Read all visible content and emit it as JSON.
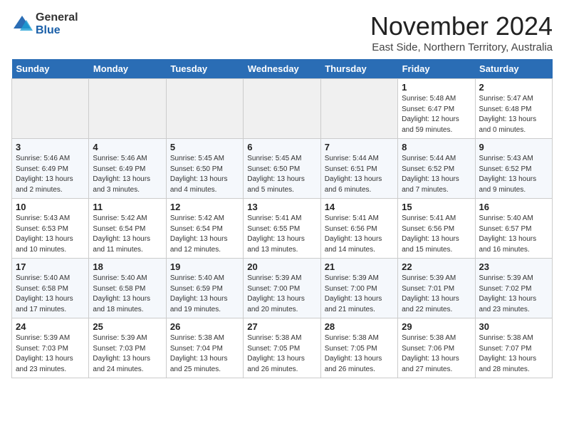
{
  "header": {
    "logo_general": "General",
    "logo_blue": "Blue",
    "month_title": "November 2024",
    "location": "East Side, Northern Territory, Australia"
  },
  "weekdays": [
    "Sunday",
    "Monday",
    "Tuesday",
    "Wednesday",
    "Thursday",
    "Friday",
    "Saturday"
  ],
  "weeks": [
    [
      {
        "day": "",
        "detail": ""
      },
      {
        "day": "",
        "detail": ""
      },
      {
        "day": "",
        "detail": ""
      },
      {
        "day": "",
        "detail": ""
      },
      {
        "day": "",
        "detail": ""
      },
      {
        "day": "1",
        "detail": "Sunrise: 5:48 AM\nSunset: 6:47 PM\nDaylight: 12 hours and 59 minutes."
      },
      {
        "day": "2",
        "detail": "Sunrise: 5:47 AM\nSunset: 6:48 PM\nDaylight: 13 hours and 0 minutes."
      }
    ],
    [
      {
        "day": "3",
        "detail": "Sunrise: 5:46 AM\nSunset: 6:49 PM\nDaylight: 13 hours and 2 minutes."
      },
      {
        "day": "4",
        "detail": "Sunrise: 5:46 AM\nSunset: 6:49 PM\nDaylight: 13 hours and 3 minutes."
      },
      {
        "day": "5",
        "detail": "Sunrise: 5:45 AM\nSunset: 6:50 PM\nDaylight: 13 hours and 4 minutes."
      },
      {
        "day": "6",
        "detail": "Sunrise: 5:45 AM\nSunset: 6:50 PM\nDaylight: 13 hours and 5 minutes."
      },
      {
        "day": "7",
        "detail": "Sunrise: 5:44 AM\nSunset: 6:51 PM\nDaylight: 13 hours and 6 minutes."
      },
      {
        "day": "8",
        "detail": "Sunrise: 5:44 AM\nSunset: 6:52 PM\nDaylight: 13 hours and 7 minutes."
      },
      {
        "day": "9",
        "detail": "Sunrise: 5:43 AM\nSunset: 6:52 PM\nDaylight: 13 hours and 9 minutes."
      }
    ],
    [
      {
        "day": "10",
        "detail": "Sunrise: 5:43 AM\nSunset: 6:53 PM\nDaylight: 13 hours and 10 minutes."
      },
      {
        "day": "11",
        "detail": "Sunrise: 5:42 AM\nSunset: 6:54 PM\nDaylight: 13 hours and 11 minutes."
      },
      {
        "day": "12",
        "detail": "Sunrise: 5:42 AM\nSunset: 6:54 PM\nDaylight: 13 hours and 12 minutes."
      },
      {
        "day": "13",
        "detail": "Sunrise: 5:41 AM\nSunset: 6:55 PM\nDaylight: 13 hours and 13 minutes."
      },
      {
        "day": "14",
        "detail": "Sunrise: 5:41 AM\nSunset: 6:56 PM\nDaylight: 13 hours and 14 minutes."
      },
      {
        "day": "15",
        "detail": "Sunrise: 5:41 AM\nSunset: 6:56 PM\nDaylight: 13 hours and 15 minutes."
      },
      {
        "day": "16",
        "detail": "Sunrise: 5:40 AM\nSunset: 6:57 PM\nDaylight: 13 hours and 16 minutes."
      }
    ],
    [
      {
        "day": "17",
        "detail": "Sunrise: 5:40 AM\nSunset: 6:58 PM\nDaylight: 13 hours and 17 minutes."
      },
      {
        "day": "18",
        "detail": "Sunrise: 5:40 AM\nSunset: 6:58 PM\nDaylight: 13 hours and 18 minutes."
      },
      {
        "day": "19",
        "detail": "Sunrise: 5:40 AM\nSunset: 6:59 PM\nDaylight: 13 hours and 19 minutes."
      },
      {
        "day": "20",
        "detail": "Sunrise: 5:39 AM\nSunset: 7:00 PM\nDaylight: 13 hours and 20 minutes."
      },
      {
        "day": "21",
        "detail": "Sunrise: 5:39 AM\nSunset: 7:00 PM\nDaylight: 13 hours and 21 minutes."
      },
      {
        "day": "22",
        "detail": "Sunrise: 5:39 AM\nSunset: 7:01 PM\nDaylight: 13 hours and 22 minutes."
      },
      {
        "day": "23",
        "detail": "Sunrise: 5:39 AM\nSunset: 7:02 PM\nDaylight: 13 hours and 23 minutes."
      }
    ],
    [
      {
        "day": "24",
        "detail": "Sunrise: 5:39 AM\nSunset: 7:03 PM\nDaylight: 13 hours and 23 minutes."
      },
      {
        "day": "25",
        "detail": "Sunrise: 5:39 AM\nSunset: 7:03 PM\nDaylight: 13 hours and 24 minutes."
      },
      {
        "day": "26",
        "detail": "Sunrise: 5:38 AM\nSunset: 7:04 PM\nDaylight: 13 hours and 25 minutes."
      },
      {
        "day": "27",
        "detail": "Sunrise: 5:38 AM\nSunset: 7:05 PM\nDaylight: 13 hours and 26 minutes."
      },
      {
        "day": "28",
        "detail": "Sunrise: 5:38 AM\nSunset: 7:05 PM\nDaylight: 13 hours and 26 minutes."
      },
      {
        "day": "29",
        "detail": "Sunrise: 5:38 AM\nSunset: 7:06 PM\nDaylight: 13 hours and 27 minutes."
      },
      {
        "day": "30",
        "detail": "Sunrise: 5:38 AM\nSunset: 7:07 PM\nDaylight: 13 hours and 28 minutes."
      }
    ]
  ]
}
